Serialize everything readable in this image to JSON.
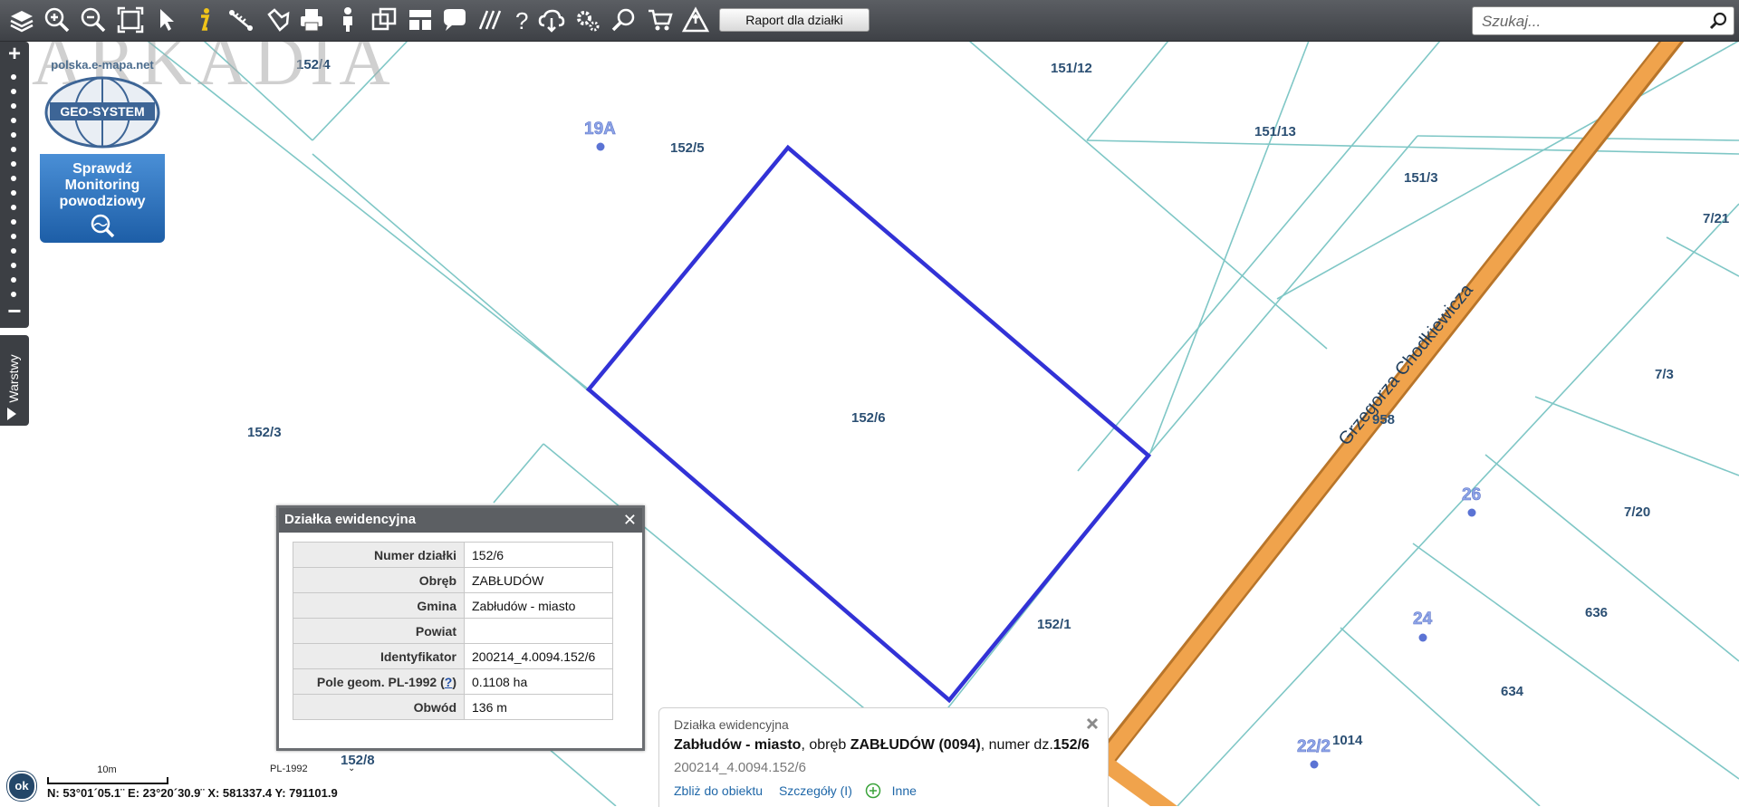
{
  "toolbar": {
    "tools": [
      "layers-icon",
      "zoom-in-icon",
      "zoom-out-icon",
      "zoom-extent-icon",
      "pointer-icon",
      "info-icon",
      "measure-distance-icon",
      "measure-area-icon",
      "print-icon",
      "street-view-icon",
      "map-compare-icon",
      "layout-icon",
      "comment-icon",
      "hatch-icon",
      "help-icon",
      "cloud-download-icon",
      "settings-icon",
      "search-location-icon",
      "cart-icon",
      "warning-icon"
    ],
    "report_label": "Raport dla działki",
    "search_placeholder": "Szukaj..."
  },
  "watermark": "ARKADIA",
  "logo": {
    "url_text": "polska.e-mapa.net",
    "brand": "GEO-SYSTEM",
    "flood_text": "Sprawdź\nMonitoring\npowodziowy"
  },
  "sidebar": {
    "layers_label": "Warstwy",
    "zoom_in": "+",
    "zoom_out": "−"
  },
  "map": {
    "parcel_labels": [
      "152/4",
      "151/12",
      "152/5",
      "151/13",
      "151/3",
      "7/21",
      "152/6",
      "152/3",
      "7/3",
      "958",
      "7/20",
      "152/1",
      "636",
      "634",
      "152/8",
      "1014"
    ],
    "address_numbers": [
      "19A",
      "26",
      "24",
      "22/2"
    ],
    "street_name": "Grzegorza Chodkiewicza",
    "colors": {
      "parcel_line": "#7fc7c6",
      "selected_outline": "#3232d6",
      "road": "#f0a34c",
      "road_edge": "#b8752a"
    }
  },
  "parcel_popup": {
    "title": "Działka ewidencyjna",
    "rows": [
      {
        "key": "Numer działki",
        "value": "152/6"
      },
      {
        "key": "Obręb",
        "value": "ZABŁUDÓW"
      },
      {
        "key": "Gmina",
        "value": "Zabłudów - miasto"
      },
      {
        "key": "Powiat",
        "value": ""
      },
      {
        "key": "Identyfikator",
        "value": "200214_4.0094.152/6"
      },
      {
        "key": "Pole geom. PL-1992",
        "value": "0.1108 ha",
        "help": "?"
      },
      {
        "key": "Obwód",
        "value": "136 m"
      }
    ]
  },
  "info_popup": {
    "type": "Działka ewidencyjna",
    "gmina": "Zabłudów - miasto",
    "obreb_prefix": ", obręb ",
    "obreb": "ZABŁUDÓW (0094)",
    "numer_prefix": ", numer dz.",
    "numer": "152/6",
    "identifier": "200214_4.0094.152/6",
    "link_zoom": "Zbliż do obiektu",
    "link_details": "Szczegóły (I)",
    "link_other": "Inne"
  },
  "status": {
    "ok": "ok",
    "scale": "10m",
    "crs": "PL-1992",
    "coordinates": "N: 53°01´05.1¨ E: 23°20´30.9¨ X: 581337.4  Y: 791101.9"
  }
}
